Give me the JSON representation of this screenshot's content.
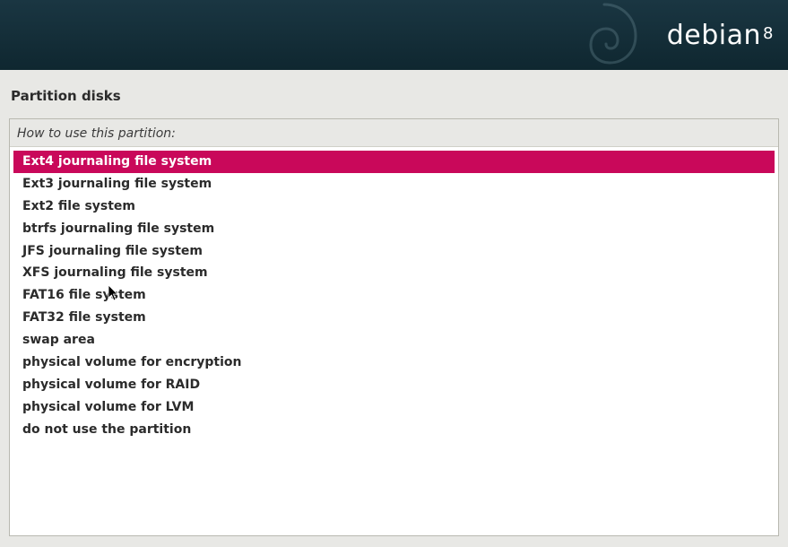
{
  "header": {
    "brand": "debian",
    "version": "8"
  },
  "page": {
    "title": "Partition disks"
  },
  "prompt": "How to use this partition:",
  "selected_index": 0,
  "options": [
    "Ext4 journaling file system",
    "Ext3 journaling file system",
    "Ext2 file system",
    "btrfs journaling file system",
    "JFS journaling file system",
    "XFS journaling file system",
    "FAT16 file system",
    "FAT32 file system",
    "swap area",
    "physical volume for encryption",
    "physical volume for RAID",
    "physical volume for LVM",
    "do not use the partition"
  ]
}
